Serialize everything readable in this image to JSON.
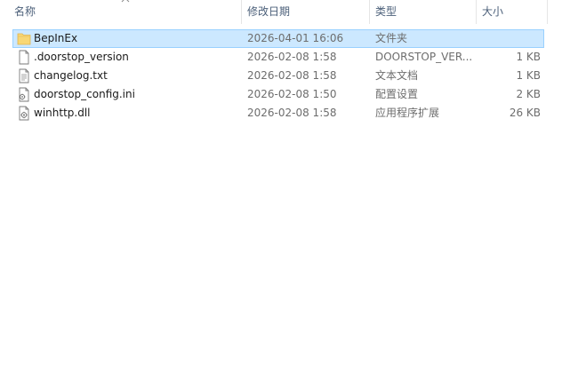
{
  "columns": {
    "name": "名称",
    "date": "修改日期",
    "type": "类型",
    "size": "大小"
  },
  "sort": {
    "column": "name",
    "direction": "ascending",
    "indicator_icon": "sort-up-chevron"
  },
  "files": [
    {
      "name": "BepInEx",
      "date": "2026-04-01 16:06",
      "type": "文件夹",
      "size": "",
      "icon": "folder-icon",
      "selected": true
    },
    {
      "name": ".doorstop_version",
      "date": "2026-02-08 1:58",
      "type": "DOORSTOP_VER...",
      "size": "1 KB",
      "icon": "blank-file-icon",
      "selected": false
    },
    {
      "name": "changelog.txt",
      "date": "2026-02-08 1:58",
      "type": "文本文档",
      "size": "1 KB",
      "icon": "text-file-icon",
      "selected": false
    },
    {
      "name": "doorstop_config.ini",
      "date": "2026-02-08 1:50",
      "type": "配置设置",
      "size": "2 KB",
      "icon": "config-file-icon",
      "selected": false
    },
    {
      "name": "winhttp.dll",
      "date": "2026-02-08 1:58",
      "type": "应用程序扩展",
      "size": "26 KB",
      "icon": "dll-file-icon",
      "selected": false
    }
  ],
  "colors": {
    "header_text": "#4c607a",
    "selection_fill": "#cce8ff",
    "selection_border": "#99d1ff",
    "folder": "#f8d775"
  }
}
